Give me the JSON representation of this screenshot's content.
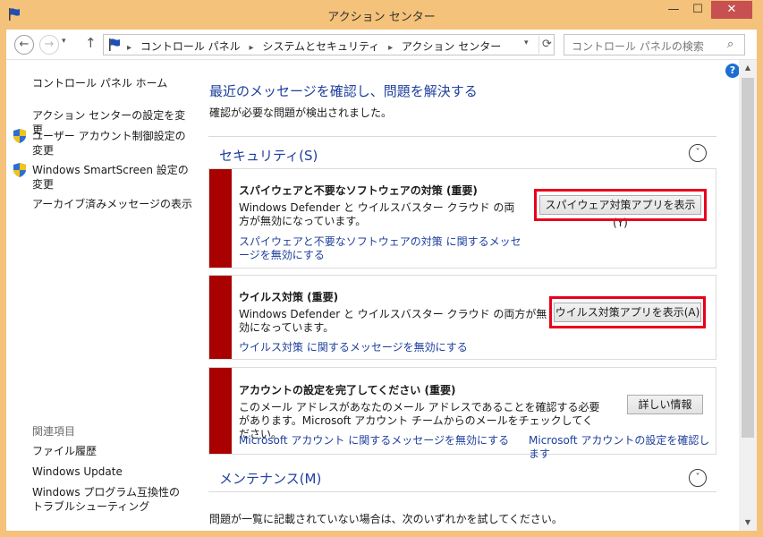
{
  "window": {
    "title": "アクション センター",
    "min_label": "—",
    "max_label": "☐",
    "close_label": "✕",
    "frame_color": "#f4c27a"
  },
  "nav": {
    "back_icon": "←",
    "forward_icon": "→",
    "recent_icon": "▾",
    "up_icon": "↑",
    "breadcrumbs": [
      "コントロール パネル",
      "システムとセキュリティ",
      "アクション センター"
    ],
    "breadcrumb_sep": "▸",
    "refresh_icon": "⟳",
    "search_placeholder": "コントロール パネルの検索",
    "search_icon": "⌕"
  },
  "left_pane": {
    "home": "コントロール パネル ホーム",
    "links": [
      "アクション センターの設定を変更",
      "ユーザー アカウント制御設定の変更",
      "Windows SmartScreen 設定の変更",
      "アーカイブ済みメッセージの表示"
    ],
    "related_heading": "関連項目",
    "related": [
      "ファイル履歴",
      "Windows Update",
      "Windows プログラム互換性のトラブルシューティング"
    ]
  },
  "main": {
    "heading": "最近のメッセージを確認し、問題を解決する",
    "subheading": "確認が必要な問題が検出されました。",
    "security_title": "セキュリティ(S)",
    "maintenance_title": "メンテナンス(M)",
    "chevron": "˅",
    "cards": [
      {
        "title": "スパイウェアと不要なソフトウェアの対策 (重要)",
        "desc": "Windows Defender と ウイルスバスター クラウド の両方が無効になっています。",
        "link": "スパイウェアと不要なソフトウェアの対策 に関するメッセージを無効にする",
        "button": "スパイウェア対策アプリを表示(Y)"
      },
      {
        "title": "ウイルス対策 (重要)",
        "desc": "Windows Defender と ウイルスバスター クラウド の両方が無効になっています。",
        "link": "ウイルス対策 に関するメッセージを無効にする",
        "button": "ウイルス対策アプリを表示(A)"
      },
      {
        "title": "アカウントの設定を完了してください (重要)",
        "desc": "このメール アドレスがあなたのメール アドレスであることを確認する必要があります。Microsoft アカウント チームからのメールをチェックしてください。",
        "link": "Microsoft アカウント に関するメッセージを無効にする",
        "link2": "Microsoft アカウントの設定を確認します",
        "button": "詳しい情報"
      }
    ],
    "bottom_text": "問題が一覧に記載されていない場合は、次のいずれかを試してください。",
    "help_icon": "?"
  },
  "scrollbar": {
    "up": "▲",
    "down": "▼"
  },
  "colors": {
    "accent": "#1e3f9c",
    "severity": "#a90000",
    "highlight": "#e8001c"
  }
}
